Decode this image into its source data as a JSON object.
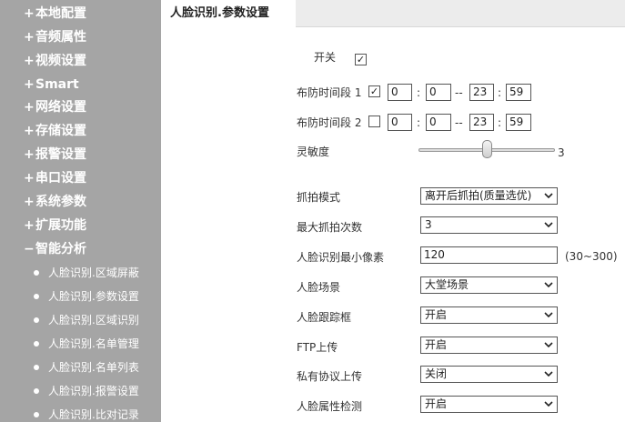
{
  "sidebar": {
    "menu": [
      {
        "sign": "+",
        "label": "本地配置"
      },
      {
        "sign": "+",
        "label": "音频属性"
      },
      {
        "sign": "+",
        "label": "视频设置"
      },
      {
        "sign": "+",
        "label": "Smart"
      },
      {
        "sign": "+",
        "label": "网络设置"
      },
      {
        "sign": "+",
        "label": "存储设置"
      },
      {
        "sign": "+",
        "label": "报警设置"
      },
      {
        "sign": "+",
        "label": "串口设置"
      },
      {
        "sign": "+",
        "label": "系统参数"
      },
      {
        "sign": "+",
        "label": "扩展功能"
      },
      {
        "sign": "−",
        "label": "智能分析"
      }
    ],
    "sub_items": [
      {
        "label": "人脸识别.区域屏蔽"
      },
      {
        "label": "人脸识别.参数设置"
      },
      {
        "label": "人脸识别.区域识别"
      },
      {
        "label": "人脸识别.名单管理"
      },
      {
        "label": "人脸识别.名单列表"
      },
      {
        "label": "人脸识别.报警设置"
      },
      {
        "label": "人脸识别.比对记录"
      }
    ]
  },
  "tab": {
    "label": "人脸识别.参数设置"
  },
  "form": {
    "switch": {
      "label": "开关",
      "checked": "✓"
    },
    "period1": {
      "label": "布防时间段 1",
      "checked": "✓",
      "start_h": "0",
      "start_m": "0",
      "dash": "--",
      "end_h": "23",
      "end_m": "59",
      "colon": ":"
    },
    "period2": {
      "label": "布防时间段 2",
      "checked": "",
      "start_h": "0",
      "start_m": "0",
      "dash": "--",
      "end_h": "23",
      "end_m": "59",
      "colon": ":"
    },
    "sensitivity": {
      "label": "灵敏度",
      "value": 3,
      "min": 1,
      "max": 5,
      "display": "3"
    },
    "capture_mode": {
      "label": "抓拍模式",
      "value": "离开后抓拍(质量选优)"
    },
    "max_captures": {
      "label": "最大抓拍次数",
      "value": "3"
    },
    "min_pixels": {
      "label": "人脸识别最小像素",
      "value": "120",
      "range": "(30~300)"
    },
    "scene": {
      "label": "人脸场景",
      "value": "大堂场景"
    },
    "track_box": {
      "label": "人脸跟踪框",
      "value": "开启"
    },
    "ftp_upload": {
      "label": "FTP上传",
      "value": "开启"
    },
    "private_upload": {
      "label": "私有协议上传",
      "value": "关闭"
    },
    "attr_detect": {
      "label": "人脸属性检测",
      "value": "开启"
    }
  }
}
